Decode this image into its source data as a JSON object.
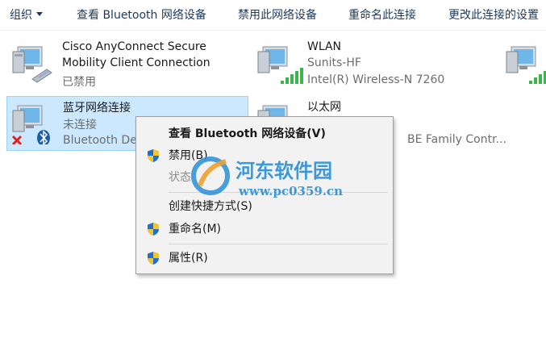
{
  "toolbar": {
    "organize": "组织",
    "view_bt": "查看 Bluetooth 网络设备",
    "disable": "禁用此网络设备",
    "rename": "重命名此连接",
    "change": "更改此连接的设置"
  },
  "connections": [
    {
      "name": "Cisco AnyConnect Secure",
      "line1": "Mobility Client Connection",
      "line2": "已禁用"
    },
    {
      "name": "WLAN",
      "line1": "Sunits-HF",
      "line2": "Intel(R) Wireless-N 7260"
    },
    {
      "name": "蓝牙网络连接",
      "line1": "未连接",
      "line2": "Bluetooth De"
    },
    {
      "name": "以太网",
      "line1": "",
      "line2": "BE Family Contr..."
    }
  ],
  "menu": {
    "view_bt": "查看 Bluetooth 网络设备(V)",
    "disable": "禁用(B)",
    "status": "状态",
    "shortcut": "创建快捷方式(S)",
    "rename": "重命名(M)",
    "properties": "属性(R)"
  },
  "watermark": {
    "name": "河东软件园",
    "url": "www.pc0359.cn"
  },
  "colors": {
    "toolbar_text": "#1e395b",
    "selection_bg": "#cce8ff",
    "selection_border": "#99d1ff",
    "signal_green": "#3bb54a",
    "watermark_blue": "#2a8fd6",
    "watermark_orange": "#f0a030"
  }
}
